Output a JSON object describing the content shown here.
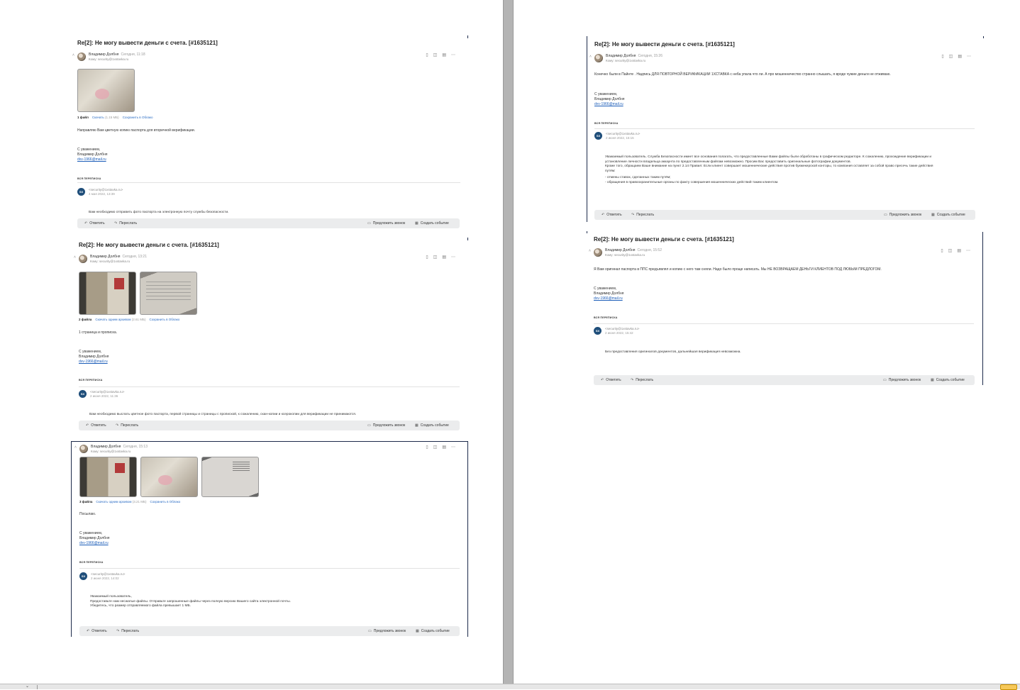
{
  "subject": "Re[2]: Не могу вывести деньги с счета. [#1635121]",
  "common": {
    "sender_name": "Владимир Долбня",
    "to_line": "Кому: security@1xstavka.ru",
    "reply_label": "Ответить",
    "forward_label": "Переслать",
    "call_label": "Предложить звонок",
    "event_label": "Создать событие",
    "thread_label": "ВСЯ ПЕРЕПИСКА",
    "quote_from": "<security@1xstavka.ru>",
    "quote_avatar": "SX",
    "signature_greeting": "С уважением,",
    "signature_name": "Владимир Долбня",
    "signature_email": "dvv-1966@mail.ru",
    "save_cloud": "Сохранить в Облако",
    "icons": [
      "bookmark-icon",
      "tag-icon",
      "calendar-icon",
      "more-icon",
      "reply-icon",
      "forward-icon",
      "video-call-icon",
      "event-icon"
    ]
  },
  "m1": {
    "time": "Сегодня, 11:18",
    "files_count": "1 файл",
    "download": "Скачать",
    "size": "(1.15 МБ)",
    "body": "Направляю Вам цветную копию паспорта для вторичной верификации.",
    "quote_date": "4 мая 2022, 13:39",
    "quote_body": "Вам необходимо отправить фото паспорта на электронную почту службы безопасности."
  },
  "m2": {
    "time": "Сегодня, 13:21",
    "files_count": "2 файла",
    "download": "Скачать одним архивом",
    "size": "(2.61 МБ)",
    "body": "1 страница и прописка.",
    "quote_date": "2 июня 2022, 11:36",
    "quote_body": "Вам необходимо выслать цветное фото паспорта, первой страницы и страницы с пропиской, к сожалению, скан-копии и ксерокопии для верификации не принимаются."
  },
  "m3": {
    "time": "Сегодня, 15:13",
    "files_count": "3 файла",
    "download": "Скачать одним архивом",
    "size": "(3.21 МБ)",
    "body": "Посылаю.",
    "quote_date": "2 июня 2022, 14:02",
    "quote_lines": [
      "Уважаемый пользователь,",
      "Предоставьте нам несжатые файлы. Отправьте запрошенные файлы через полную версию Вашего сайта электронной почты.",
      "Убедитесь, что размер отправляемого файла превышает 1 МБ."
    ]
  },
  "m4": {
    "time": "Сегодня, 15:26",
    "body": "Конечно были в Пайнте . Надпись ДЛЯ ПОВТОРНОЙ ВЕРИФИКАЦИИ 1ХСТАВКА с неба упала что ли. А про мошенничество странно слышать, я вроде чужие деньги не отжимаю.",
    "quote_date": "2 июня 2022, 15:15",
    "quote_lines": [
      "Уважаемый пользователь. Служба Безопасности имеет все основания полагать, что предоставленные Вами файлы были обработаны в графическом редакторе. К сожалению, прохождение верификации и",
      "установление личности владельца аккаунта по предоставленным файлам невозможно. Просим Вас предоставить оригинальные фотографии документов.",
      "Кроме того, обращаем Ваше внимание на пункт 2.14 Правил: Если клиент совершает мошеннические действия против букмекерской конторы, то компания оставляет за собой право пресечь такие действия",
      "путём:"
    ],
    "quote_list": [
      "- отмены ставок, сделанных таким путём;",
      "- обращения в правоохранительные органы по факту совершения мошеннических действий таким клиентом."
    ]
  },
  "m5": {
    "time": "Сегодня, 15:52",
    "body": "Я Вам оригинал паспорта в ППС предъявлял и копию с него там сняли. Надо было проще написать. Мы НЕ ВОЗВРАЩАЕМ ДЕНЬГИ КЛИЕНТОВ ПОД ЛЮБЫМ ПРЕДЛОГОМ.",
    "quote_date": "2 июня 2022, 15:42",
    "quote_body": "Без предоставления оригиналов документов, дальнейшая верификация невозможна."
  }
}
